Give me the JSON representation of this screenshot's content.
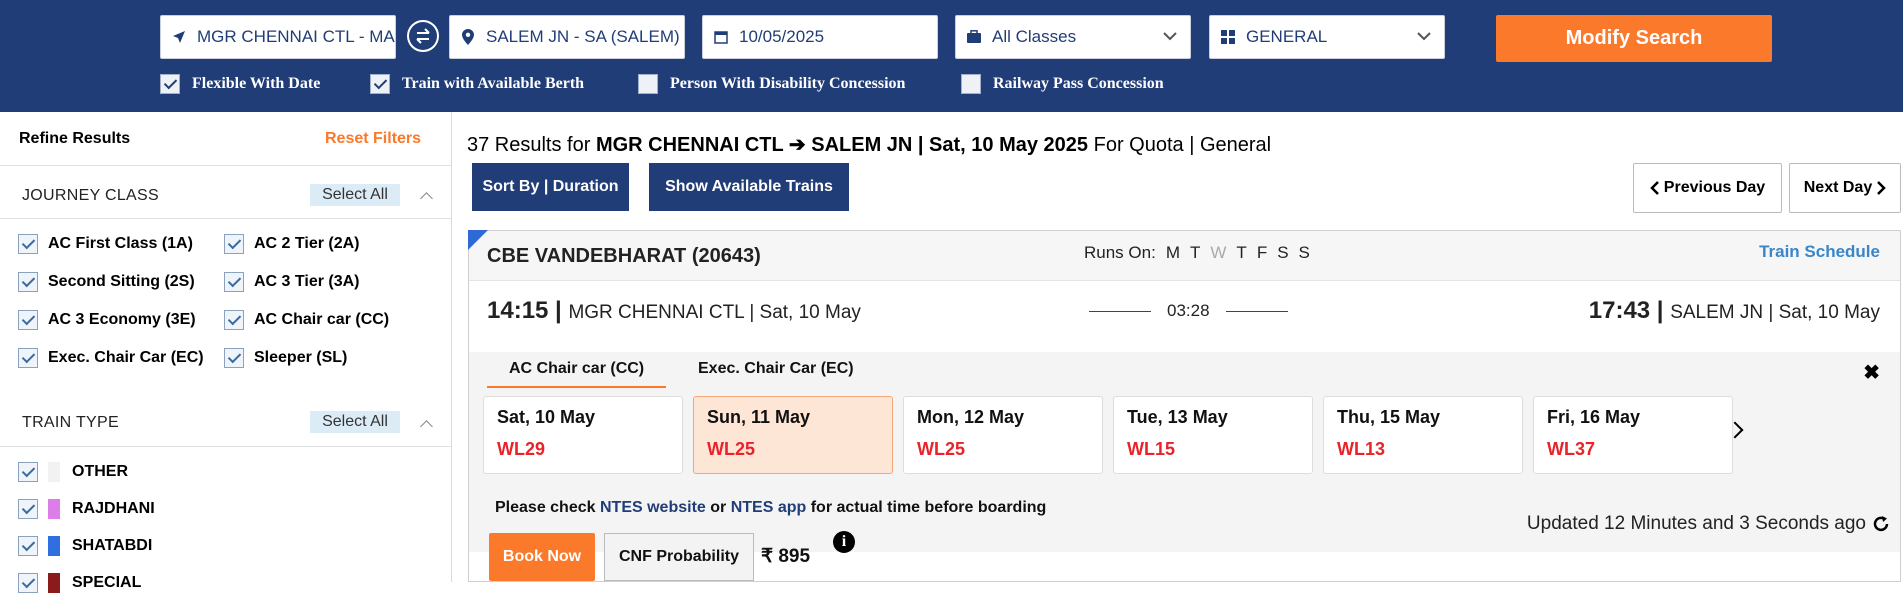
{
  "search": {
    "from": "MGR CHENNAI CTL - MAS",
    "to": "SALEM JN - SA (SALEM)",
    "date": "10/05/2025",
    "class": "All Classes",
    "quota": "GENERAL",
    "modify_label": "Modify Search",
    "options": [
      {
        "label": "Flexible With Date",
        "checked": true
      },
      {
        "label": "Train with Available Berth",
        "checked": true
      },
      {
        "label": "Person With Disability Concession",
        "checked": false
      },
      {
        "label": "Railway Pass Concession",
        "checked": false
      }
    ]
  },
  "sidebar": {
    "title": "Refine Results",
    "reset": "Reset Filters",
    "journey_class": {
      "title": "JOURNEY CLASS",
      "select_all": "Select All",
      "items": [
        "AC First Class (1A)",
        "AC 2 Tier (2A)",
        "Second Sitting (2S)",
        "AC 3 Tier (3A)",
        "AC 3 Economy (3E)",
        "AC Chair car (CC)",
        "Exec. Chair Car (EC)",
        "Sleeper (SL)"
      ]
    },
    "train_type": {
      "title": "TRAIN TYPE",
      "select_all": "Select All",
      "items": [
        {
          "label": "OTHER",
          "color": "#f2f2f2"
        },
        {
          "label": "RAJDHANI",
          "color": "#dd7ee8"
        },
        {
          "label": "SHATABDI",
          "color": "#2f6fe0"
        },
        {
          "label": "SPECIAL",
          "color": "#8b1a1a"
        }
      ]
    }
  },
  "results": {
    "count_text": "37 Results for",
    "route": "MGR CHENNAI CTL ➔ SALEM JN | Sat, 10 May 2025",
    "quota_text": "For Quota | General",
    "sort_label": "Sort By | Duration",
    "show_label": "Show Available Trains",
    "prev_day": "Previous Day",
    "next_day": "Next Day"
  },
  "train": {
    "name": "CBE VANDEBHARAT (20643)",
    "runs_on_label": "Runs On:",
    "runs": [
      {
        "d": "M",
        "on": true
      },
      {
        "d": "T",
        "on": true
      },
      {
        "d": "W",
        "on": false
      },
      {
        "d": "T",
        "on": true
      },
      {
        "d": "F",
        "on": true
      },
      {
        "d": "S",
        "on": true
      },
      {
        "d": "S",
        "on": true
      }
    ],
    "schedule_label": "Train Schedule",
    "dep_time": "14:15",
    "dep_station": "MGR CHENNAI CTL | Sat, 10 May",
    "duration": "03:28",
    "arr_time": "17:43",
    "arr_station": "SALEM JN | Sat, 10 May",
    "class_tabs": [
      "AC Chair car (CC)",
      "Exec. Chair Car (EC)"
    ],
    "availability": [
      {
        "date": "Sat, 10 May",
        "status": "WL29"
      },
      {
        "date": "Sun, 11 May",
        "status": "WL25"
      },
      {
        "date": "Mon, 12 May",
        "status": "WL25"
      },
      {
        "date": "Tue, 13 May",
        "status": "WL15"
      },
      {
        "date": "Thu, 15 May",
        "status": "WL13"
      },
      {
        "date": "Fri, 16 May",
        "status": "WL37"
      }
    ],
    "note_pre": "Please check",
    "note_link1": "NTES website",
    "note_mid": "or",
    "note_link2": "NTES app",
    "note_post": "for actual time before boarding",
    "book_label": "Book Now",
    "cnf_label": "CNF Probability",
    "fare": "₹ 895",
    "updated": "Updated 12 Minutes and 3 Seconds ago"
  }
}
